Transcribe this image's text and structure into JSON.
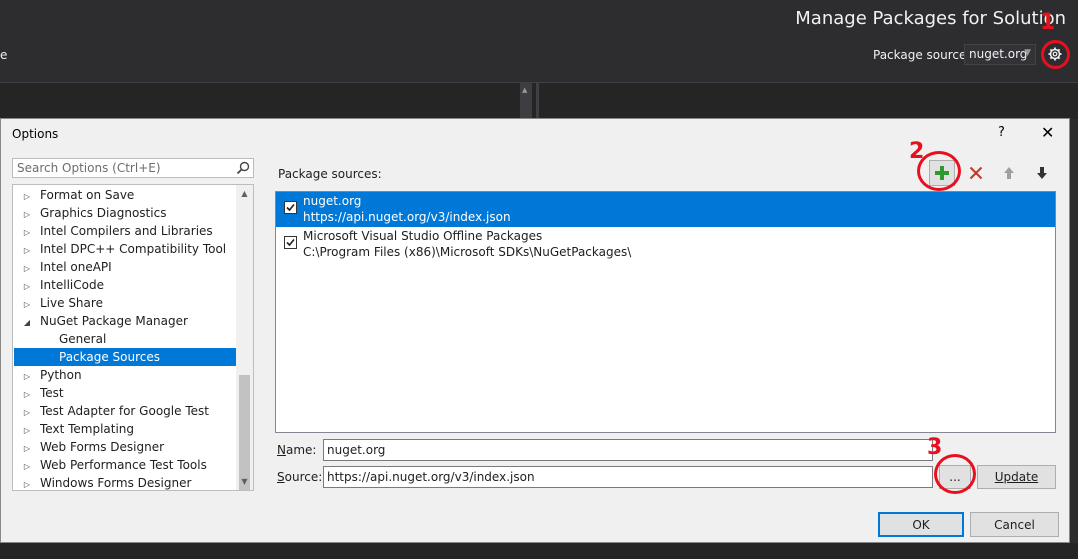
{
  "host": {
    "title": "Manage Packages for Solution",
    "left_fragment": "e",
    "package_source_label": "Package source:",
    "package_source_value": "nuget.org"
  },
  "annotations": [
    "1",
    "2",
    "3"
  ],
  "dialog": {
    "title": "Options",
    "help": "?",
    "close": "✕",
    "search_placeholder": "Search Options (Ctrl+E)",
    "tree": [
      {
        "label": "Format on Save",
        "arrow": "▷",
        "indent": 0,
        "selected": false
      },
      {
        "label": "Graphics Diagnostics",
        "arrow": "▷",
        "indent": 0,
        "selected": false
      },
      {
        "label": "Intel Compilers and Libraries",
        "arrow": "▷",
        "indent": 0,
        "selected": false
      },
      {
        "label": "Intel DPC++ Compatibility Tool",
        "arrow": "▷",
        "indent": 0,
        "selected": false
      },
      {
        "label": "Intel oneAPI",
        "arrow": "▷",
        "indent": 0,
        "selected": false
      },
      {
        "label": "IntelliCode",
        "arrow": "▷",
        "indent": 0,
        "selected": false
      },
      {
        "label": "Live Share",
        "arrow": "▷",
        "indent": 0,
        "selected": false
      },
      {
        "label": "NuGet Package Manager",
        "arrow": "◢",
        "indent": 0,
        "selected": false
      },
      {
        "label": "General",
        "arrow": "",
        "indent": 1,
        "selected": false
      },
      {
        "label": "Package Sources",
        "arrow": "",
        "indent": 1,
        "selected": true
      },
      {
        "label": "Python",
        "arrow": "▷",
        "indent": 0,
        "selected": false
      },
      {
        "label": "Test",
        "arrow": "▷",
        "indent": 0,
        "selected": false
      },
      {
        "label": "Test Adapter for Google Test",
        "arrow": "▷",
        "indent": 0,
        "selected": false
      },
      {
        "label": "Text Templating",
        "arrow": "▷",
        "indent": 0,
        "selected": false
      },
      {
        "label": "Web Forms Designer",
        "arrow": "▷",
        "indent": 0,
        "selected": false
      },
      {
        "label": "Web Performance Test Tools",
        "arrow": "▷",
        "indent": 0,
        "selected": false
      },
      {
        "label": "Windows Forms Designer",
        "arrow": "▷",
        "indent": 0,
        "selected": false
      }
    ],
    "package_sources_label": "Package sources:",
    "sources": [
      {
        "name": "nuget.org",
        "url": "https://api.nuget.org/v3/index.json",
        "checked": true,
        "selected": true
      },
      {
        "name": "Microsoft Visual Studio Offline Packages",
        "url": "C:\\Program Files (x86)\\Microsoft SDKs\\NuGetPackages\\",
        "checked": true,
        "selected": false
      }
    ],
    "name_label_key": "N",
    "name_label_rest": "ame:",
    "name_value": "nuget.org",
    "source_label_key": "S",
    "source_label_rest": "ource:",
    "source_value": "https://api.nuget.org/v3/index.json",
    "browse_label": "...",
    "update_label": "Update",
    "ok_label": "OK",
    "cancel_label": "Cancel"
  },
  "colors": {
    "accent": "#0078d7",
    "annotation": "#e8101e",
    "add_green": "#2e9a2e",
    "remove_red": "#c0392b"
  }
}
